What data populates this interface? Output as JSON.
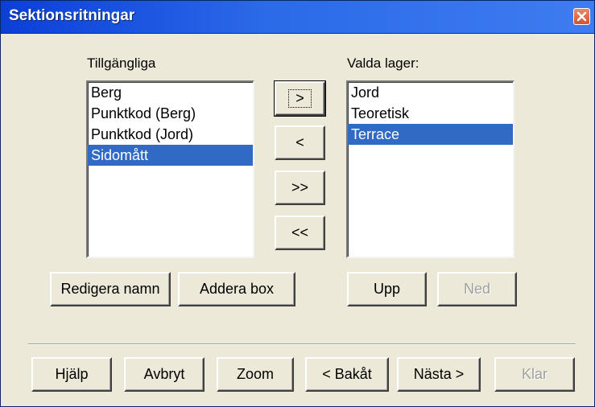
{
  "window": {
    "title": "Sektionsritningar"
  },
  "available": {
    "label": "Tillgängliga",
    "items": [
      "Berg",
      "Punktkod (Berg)",
      "Punktkod (Jord)",
      "Sidomått"
    ],
    "selected_index": 3
  },
  "chosen": {
    "label": "Valda lager:",
    "items": [
      "Jord",
      "Teoretisk",
      "Terrace"
    ],
    "selected_index": 2
  },
  "transfer": {
    "add": ">",
    "remove": "<",
    "add_all": ">>",
    "remove_all": "<<"
  },
  "edit": {
    "rename": "Redigera namn",
    "add_box": "Addera box",
    "up": "Upp",
    "down": "Ned"
  },
  "footer": {
    "help": "Hjälp",
    "cancel": "Avbryt",
    "zoom": "Zoom",
    "back": "< Bakåt",
    "next": "Nästa >",
    "finish": "Klar"
  }
}
